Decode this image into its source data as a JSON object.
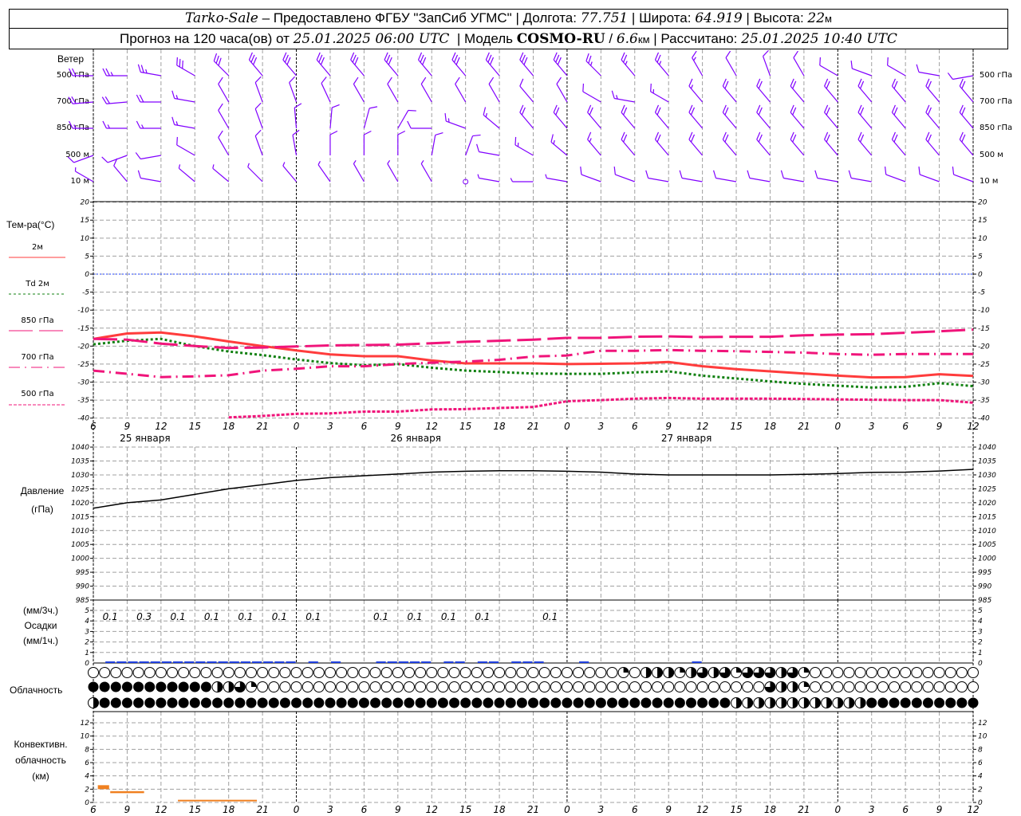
{
  "header": {
    "station": "Tarko-Sale",
    "provider": "– Предоставлено ФГБУ \"ЗапСиб УГМС\"",
    "lon_label": "Долгота:",
    "lon": "77.751",
    "lat_label": "Широта:",
    "lat": "64.919",
    "alt_label": "Высота:",
    "alt": "22",
    "alt_unit": "м",
    "forecast_label": "Прогноз на 120 часа(ов) от",
    "forecast_start": "25.01.2025 06:00 UTC",
    "model_label": "Модель",
    "model": "COSMO-RU",
    "resolution": "6.6",
    "resolution_unit": "км",
    "computed_label": "Рассчитано:",
    "computed": "25.01.2025 10:40 UTC"
  },
  "labels": {
    "wind": "Ветер",
    "levels": [
      "500 гПа",
      "700 гПа",
      "850 гПа",
      "500 м",
      "10 м"
    ],
    "temp_title": "Тем-ра(°C)",
    "legend": [
      {
        "name": "2м",
        "color": "#ff3c3c",
        "dash": "solid"
      },
      {
        "name": "Td  2м",
        "color": "#108010",
        "dash": "dotted"
      },
      {
        "name": "850 гПа",
        "color": "#f0147a",
        "dash": "long-dash"
      },
      {
        "name": "700 гПа",
        "color": "#f0147a",
        "dash": "dash-dot"
      },
      {
        "name": "500 гПа",
        "color": "#f0147a",
        "dash": "short-dash"
      }
    ],
    "pressure": [
      "Давление",
      "(гПа)"
    ],
    "precip": [
      "(мм/3ч.)",
      "Осадки",
      "(мм/1ч.)"
    ],
    "clouds": "Облачность",
    "convective": [
      "Конвективн.",
      "облачность",
      "(км)"
    ]
  },
  "chart_data": {
    "type": "line",
    "x_hour_labels": [
      "6",
      "9",
      "12",
      "15",
      "18",
      "21",
      "0",
      "3",
      "6",
      "9",
      "12",
      "15",
      "18",
      "21",
      "0",
      "3",
      "6",
      "9",
      "12",
      "15",
      "18",
      "21",
      "0",
      "3",
      "6",
      "9",
      "12"
    ],
    "date_labels": [
      "25  января",
      "26  января",
      "27  января"
    ],
    "wind": {
      "levels": [
        "500 гПа",
        "700 гПа",
        "850 гПа",
        "500 м",
        "10 м"
      ],
      "color": "#8000ff",
      "direction_deg": [
        [
          270,
          270,
          280,
          300,
          315,
          320,
          320,
          320,
          320,
          320,
          320,
          320,
          320,
          320,
          320,
          315,
          320,
          320,
          330,
          330,
          340,
          330,
          300,
          290,
          300,
          280,
          260
        ],
        [
          265,
          265,
          270,
          280,
          330,
          340,
          340,
          335,
          330,
          330,
          330,
          330,
          330,
          320,
          330,
          300,
          280,
          300,
          320,
          320,
          320,
          320,
          320,
          320,
          320,
          320,
          320
        ],
        [
          270,
          270,
          270,
          280,
          330,
          340,
          355,
          5,
          15,
          30,
          270,
          290,
          310,
          320,
          320,
          320,
          320,
          320,
          320,
          320,
          320,
          320,
          320,
          320,
          320,
          320,
          320
        ],
        [
          250,
          250,
          260,
          300,
          330,
          340,
          350,
          0,
          0,
          0,
          10,
          20,
          280,
          300,
          310,
          320,
          320,
          320,
          320,
          320,
          320,
          320,
          320,
          320,
          320,
          320,
          320
        ],
        [
          300,
          320,
          280,
          310,
          310,
          315,
          320,
          325,
          330,
          330,
          330,
          0,
          280,
          270,
          280,
          290,
          290,
          280,
          280,
          280,
          280,
          280,
          280,
          280,
          290,
          290,
          290
        ]
      ],
      "speed": [
        [
          20,
          25,
          25,
          30,
          30,
          30,
          30,
          30,
          30,
          30,
          30,
          30,
          30,
          30,
          30,
          25,
          25,
          25,
          15,
          10,
          10,
          10,
          10,
          10,
          10,
          10,
          10
        ],
        [
          20,
          20,
          20,
          15,
          10,
          10,
          10,
          10,
          10,
          10,
          10,
          10,
          10,
          10,
          10,
          10,
          15,
          15,
          15,
          20,
          20,
          20,
          20,
          20,
          20,
          20,
          20
        ],
        [
          15,
          15,
          15,
          15,
          10,
          10,
          10,
          10,
          10,
          10,
          10,
          15,
          15,
          20,
          20,
          20,
          20,
          20,
          20,
          20,
          20,
          20,
          20,
          20,
          20,
          20,
          20
        ],
        [
          10,
          10,
          10,
          10,
          10,
          10,
          10,
          10,
          10,
          10,
          10,
          10,
          10,
          15,
          15,
          15,
          20,
          20,
          20,
          20,
          20,
          20,
          20,
          20,
          20,
          20,
          20
        ],
        [
          5,
          10,
          10,
          5,
          5,
          5,
          5,
          5,
          5,
          5,
          5,
          0,
          5,
          5,
          5,
          10,
          10,
          10,
          10,
          10,
          10,
          10,
          10,
          10,
          10,
          10,
          10
        ]
      ]
    },
    "temperature": {
      "ylim": [
        -40,
        20
      ],
      "ticks": [
        20,
        15,
        10,
        5,
        0,
        -5,
        -10,
        -15,
        -20,
        -25,
        -30,
        -35,
        -40
      ],
      "zero_line_color": "#2040ff",
      "series": [
        {
          "name": "2м",
          "values": [
            -18,
            -16.5,
            -16.2,
            -17.3,
            -18.7,
            -20,
            -21.2,
            -22.3,
            -22.8,
            -22.8,
            -24,
            -24.8,
            -24.8,
            -24.8,
            -25,
            -24.9,
            -24.8,
            -24.4,
            -25.6,
            -26.4,
            -27,
            -27.6,
            -28.2,
            -28.7,
            -28.6,
            -27.8,
            -28.3
          ]
        },
        {
          "name": "Td  2м",
          "values": [
            -19.5,
            -18.5,
            -18,
            -20,
            -21.5,
            -22.5,
            -23.7,
            -24.7,
            -25.3,
            -25,
            -26,
            -26.8,
            -27.2,
            -27.6,
            -27.7,
            -27.7,
            -27.3,
            -27,
            -28.2,
            -29,
            -29.8,
            -30.5,
            -31,
            -31.5,
            -31.3,
            -30.3,
            -31.1
          ]
        },
        {
          "name": "850 гПа",
          "values": [
            -18,
            -18.2,
            -19.3,
            -20,
            -20.5,
            -20.4,
            -20.1,
            -19.8,
            -19.7,
            -19.6,
            -19.2,
            -18.8,
            -18.5,
            -18.2,
            -17.7,
            -17.7,
            -17.4,
            -17.3,
            -17.5,
            -17.4,
            -17.4,
            -17,
            -16.8,
            -16.7,
            -16.3,
            -15.9,
            -15.4
          ]
        },
        {
          "name": "700 гПа",
          "values": [
            -26.8,
            -27.7,
            -28.6,
            -28.4,
            -28.1,
            -26.8,
            -26.3,
            -25.6,
            -25.6,
            -25,
            -24.6,
            -24.3,
            -23.8,
            -22.9,
            -22.6,
            -21.3,
            -21.3,
            -21.1,
            -21.3,
            -21.4,
            -21.6,
            -21.8,
            -22.2,
            -22.4,
            -22.2,
            -22.2,
            -22.2
          ]
        },
        {
          "name": "500 гПа",
          "values": [
            null,
            null,
            null,
            null,
            -39.8,
            -39.4,
            -38.8,
            -38.7,
            -38.2,
            -38.2,
            -37.6,
            -37.5,
            -37.2,
            -36.9,
            -35.3,
            -35,
            -34.6,
            -34.4,
            -34.6,
            -34.6,
            -34.6,
            -34.7,
            -34.8,
            -34.9,
            -35,
            -35,
            -35.7
          ]
        }
      ]
    },
    "pressure": {
      "ylim": [
        985,
        1040
      ],
      "ticks": [
        1040,
        1035,
        1030,
        1025,
        1020,
        1015,
        1010,
        1005,
        1000,
        995,
        990,
        985
      ],
      "values": [
        1018,
        1020,
        1021,
        1023,
        1025,
        1026.5,
        1028,
        1029,
        1029.7,
        1030.3,
        1031,
        1031.3,
        1031.5,
        1031.5,
        1031.3,
        1031,
        1030.3,
        1030,
        1030,
        1030,
        1030,
        1030.2,
        1030.5,
        1030.9,
        1031,
        1031.4,
        1032
      ]
    },
    "precipitation": {
      "ylim": [
        0,
        5
      ],
      "ticks": [
        5,
        4,
        3,
        2,
        1,
        0
      ],
      "bar_color": "#2040e0",
      "per_3h": [
        "0.1",
        "0.3",
        "0.1",
        "0.1",
        "0.1",
        "0.1",
        "0.1",
        "",
        "0.1",
        "0.1",
        "0.1",
        "0.1",
        "",
        "0.1",
        "",
        "",
        "",
        "",
        "",
        "",
        "",
        "",
        "",
        "",
        "",
        ""
      ],
      "hourly": [
        0,
        0.1,
        0.1,
        0.1,
        0.1,
        0.15,
        0.15,
        0.1,
        0.1,
        0.1,
        0.05,
        0.1,
        0.1,
        0.05,
        0.05,
        0.05,
        0.05,
        0.05,
        0,
        0.05,
        0,
        0.05,
        0,
        0,
        0,
        0.05,
        0.05,
        0.05,
        0.05,
        0.05,
        0,
        0.05,
        0.05,
        0,
        0.05,
        0.05,
        0,
        0.05,
        0.05,
        0.05,
        0,
        0,
        0,
        0.05,
        0,
        0,
        0,
        0,
        0,
        0,
        0,
        0,
        0,
        0.05,
        0,
        0,
        0,
        0,
        0,
        0,
        0,
        0,
        0,
        0,
        0,
        0,
        0,
        0,
        0,
        0,
        0,
        0,
        0,
        0,
        0,
        0,
        0,
        0
      ]
    },
    "cloud_cover_quarters": {
      "high": "0000000000000000000000000000000000000000000000010222123231333231000000000000000",
      "middle": "4444444444422310000000000000000000000000000000000000000000003221000000000000000",
      "low": "2444444444444444444444444444444444444444444444444444444442222222222224444444444431"
    },
    "convective": {
      "ylim": [
        0,
        12
      ],
      "ticks": [
        12,
        10,
        8,
        6,
        4,
        2,
        0
      ],
      "color": "#f08020",
      "segments_hours_km": [
        [
          0.4,
          1.4,
          2.0,
          2.6
        ],
        [
          1.5,
          4.5,
          1.4,
          1.7
        ],
        [
          7.5,
          14.5,
          0.2,
          0.4
        ]
      ]
    }
  }
}
